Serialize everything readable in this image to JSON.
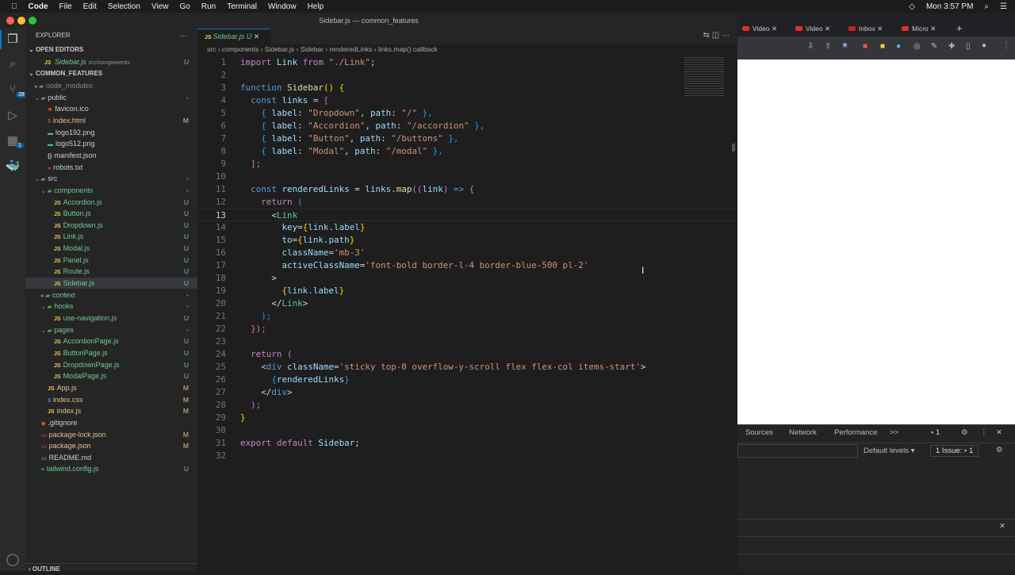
{
  "menubar": {
    "app": "Code",
    "items": [
      "File",
      "Edit",
      "Selection",
      "View",
      "Go",
      "Run",
      "Terminal",
      "Window",
      "Help"
    ],
    "clock": "Mon 3:57 PM"
  },
  "window": {
    "title": "Sidebar.js — common_features"
  },
  "activity": {
    "scm_badge": "28",
    "ext_badge": "1"
  },
  "explorer": {
    "title": "EXPLORER",
    "open_editors": "OPEN EDITORS",
    "open_file": "Sidebar.js",
    "open_file_path": "src/components",
    "open_file_status": "U",
    "project": "COMMON_FEATURES",
    "outline": "OUTLINE",
    "rows": [
      {
        "name": "node_modules",
        "indent": 1,
        "kind": "folder",
        "status": "",
        "color": "#888"
      },
      {
        "name": "public",
        "indent": 1,
        "kind": "folder-open",
        "status": "•",
        "color": "#ccc"
      },
      {
        "name": "favicon.ico",
        "indent": 2,
        "kind": "ico",
        "status": "",
        "color": "#ccc"
      },
      {
        "name": "index.html",
        "indent": 2,
        "kind": "html",
        "status": "M",
        "color": "#e2c08d"
      },
      {
        "name": "logo192.png",
        "indent": 2,
        "kind": "img",
        "status": "",
        "color": "#ccc"
      },
      {
        "name": "logo512.png",
        "indent": 2,
        "kind": "img",
        "status": "",
        "color": "#ccc"
      },
      {
        "name": "manifest.json",
        "indent": 2,
        "kind": "json",
        "status": "",
        "color": "#ccc"
      },
      {
        "name": "robots.txt",
        "indent": 2,
        "kind": "txt",
        "status": "",
        "color": "#ccc"
      },
      {
        "name": "src",
        "indent": 1,
        "kind": "folder-open",
        "status": "•",
        "color": "#ccc"
      },
      {
        "name": "components",
        "indent": 2,
        "kind": "folder-open",
        "status": "•",
        "color": "#73c991"
      },
      {
        "name": "Accordion.js",
        "indent": 3,
        "kind": "js",
        "status": "U",
        "color": "#73c991"
      },
      {
        "name": "Button.js",
        "indent": 3,
        "kind": "js",
        "status": "U",
        "color": "#73c991"
      },
      {
        "name": "Dropdown.js",
        "indent": 3,
        "kind": "js",
        "status": "U",
        "color": "#73c991"
      },
      {
        "name": "Link.js",
        "indent": 3,
        "kind": "js",
        "status": "U",
        "color": "#73c991"
      },
      {
        "name": "Modal.js",
        "indent": 3,
        "kind": "js",
        "status": "U",
        "color": "#73c991"
      },
      {
        "name": "Panel.js",
        "indent": 3,
        "kind": "js",
        "status": "U",
        "color": "#73c991"
      },
      {
        "name": "Route.js",
        "indent": 3,
        "kind": "js",
        "status": "U",
        "color": "#73c991"
      },
      {
        "name": "Sidebar.js",
        "indent": 3,
        "kind": "js",
        "status": "U",
        "color": "#73c991",
        "selected": true
      },
      {
        "name": "context",
        "indent": 2,
        "kind": "folder",
        "status": "•",
        "color": "#73c991"
      },
      {
        "name": "hooks",
        "indent": 2,
        "kind": "folder-open",
        "status": "•",
        "color": "#73c991"
      },
      {
        "name": "use-navigation.js",
        "indent": 3,
        "kind": "js",
        "status": "U",
        "color": "#73c991"
      },
      {
        "name": "pages",
        "indent": 2,
        "kind": "folder-open",
        "status": "•",
        "color": "#73c991"
      },
      {
        "name": "AccordionPage.js",
        "indent": 3,
        "kind": "js",
        "status": "U",
        "color": "#73c991"
      },
      {
        "name": "ButtonPage.js",
        "indent": 3,
        "kind": "js",
        "status": "U",
        "color": "#73c991"
      },
      {
        "name": "DropdownPage.js",
        "indent": 3,
        "kind": "js",
        "status": "U",
        "color": "#73c991"
      },
      {
        "name": "ModalPage.js",
        "indent": 3,
        "kind": "js",
        "status": "U",
        "color": "#73c991"
      },
      {
        "name": "App.js",
        "indent": 2,
        "kind": "js",
        "status": "M",
        "color": "#e2c08d"
      },
      {
        "name": "index.css",
        "indent": 2,
        "kind": "css",
        "status": "M",
        "color": "#e2c08d"
      },
      {
        "name": "index.js",
        "indent": 2,
        "kind": "js",
        "status": "M",
        "color": "#e2c08d"
      },
      {
        "name": ".gitignore",
        "indent": 1,
        "kind": "git",
        "status": "",
        "color": "#ccc"
      },
      {
        "name": "package-lock.json",
        "indent": 1,
        "kind": "npm",
        "status": "M",
        "color": "#e2c08d"
      },
      {
        "name": "package.json",
        "indent": 1,
        "kind": "npm",
        "status": "M",
        "color": "#e2c08d"
      },
      {
        "name": "README.md",
        "indent": 1,
        "kind": "md",
        "status": "",
        "color": "#ccc"
      },
      {
        "name": "tailwind.config.js",
        "indent": 1,
        "kind": "tw",
        "status": "U",
        "color": "#73c991"
      }
    ]
  },
  "editor": {
    "tab": "Sidebar.js",
    "tab_status": "U",
    "breadcrumbs": [
      "src",
      "components",
      "Sidebar.js",
      "Sidebar",
      "renderedLinks",
      "links.map() callback"
    ],
    "current_line": 13,
    "lines": [
      [
        [
          "import",
          "kw"
        ],
        [
          " Link ",
          "var"
        ],
        [
          "from",
          "kw"
        ],
        [
          " \"./Link\"",
          "str"
        ],
        [
          ";",
          "p"
        ]
      ],
      [],
      [
        [
          "function",
          "st2"
        ],
        [
          " Sidebar",
          "fn"
        ],
        [
          "() ",
          "b1"
        ],
        [
          "{",
          "b1"
        ]
      ],
      [
        [
          "  const",
          "st2"
        ],
        [
          " links ",
          "var"
        ],
        [
          "= ",
          "p"
        ],
        [
          "[",
          "b2"
        ]
      ],
      [
        [
          "    { ",
          "b3"
        ],
        [
          "label",
          "var"
        ],
        [
          ": ",
          "p"
        ],
        [
          "\"Dropdown\"",
          "str"
        ],
        [
          ", ",
          "p"
        ],
        [
          "path",
          "var"
        ],
        [
          ": ",
          "p"
        ],
        [
          "\"/\"",
          "str"
        ],
        [
          " },",
          "b3"
        ]
      ],
      [
        [
          "    { ",
          "b3"
        ],
        [
          "label",
          "var"
        ],
        [
          ": ",
          "p"
        ],
        [
          "\"Accordion\"",
          "str"
        ],
        [
          ", ",
          "p"
        ],
        [
          "path",
          "var"
        ],
        [
          ": ",
          "p"
        ],
        [
          "\"/accordion\"",
          "str"
        ],
        [
          " },",
          "b3"
        ]
      ],
      [
        [
          "    { ",
          "b3"
        ],
        [
          "label",
          "var"
        ],
        [
          ": ",
          "p"
        ],
        [
          "\"Button\"",
          "str"
        ],
        [
          ", ",
          "p"
        ],
        [
          "path",
          "var"
        ],
        [
          ": ",
          "p"
        ],
        [
          "\"/buttons\"",
          "str"
        ],
        [
          " },",
          "b3"
        ]
      ],
      [
        [
          "    { ",
          "b3"
        ],
        [
          "label",
          "var"
        ],
        [
          ": ",
          "p"
        ],
        [
          "\"Modal\"",
          "str"
        ],
        [
          ", ",
          "p"
        ],
        [
          "path",
          "var"
        ],
        [
          ": ",
          "p"
        ],
        [
          "\"/modal\"",
          "str"
        ],
        [
          " },",
          "b3"
        ]
      ],
      [
        [
          "  ];",
          "b2"
        ]
      ],
      [],
      [
        [
          "  const",
          "st2"
        ],
        [
          " renderedLinks ",
          "var"
        ],
        [
          "= ",
          "p"
        ],
        [
          "links",
          "var"
        ],
        [
          ".",
          "p"
        ],
        [
          "map",
          "fn"
        ],
        [
          "((",
          "b2"
        ],
        [
          "link",
          "var"
        ],
        [
          ") ",
          "b2"
        ],
        [
          "=> ",
          "st2"
        ],
        [
          "{",
          "b2"
        ]
      ],
      [
        [
          "    return ",
          "kw"
        ],
        [
          "(",
          "b3"
        ]
      ],
      [
        [
          "      <",
          "p"
        ],
        [
          "Link",
          "tag"
        ]
      ],
      [
        [
          "        key",
          "var"
        ],
        [
          "=",
          "p"
        ],
        [
          "{",
          "b1"
        ],
        [
          "link.label",
          "var"
        ],
        [
          "}",
          "b1"
        ]
      ],
      [
        [
          "        to",
          "var"
        ],
        [
          "=",
          "p"
        ],
        [
          "{",
          "b1"
        ],
        [
          "link.path",
          "var"
        ],
        [
          "}",
          "b1"
        ]
      ],
      [
        [
          "        className",
          "var"
        ],
        [
          "=",
          "p"
        ],
        [
          "'mb-3'",
          "str"
        ]
      ],
      [
        [
          "        activeClassName",
          "var"
        ],
        [
          "=",
          "p"
        ],
        [
          "'font-bold border-l-4 border-blue-500 pl-2'",
          "str"
        ]
      ],
      [
        [
          "      >",
          "p"
        ]
      ],
      [
        [
          "        {",
          "b1"
        ],
        [
          "link.label",
          "var"
        ],
        [
          "}",
          "b1"
        ]
      ],
      [
        [
          "      </",
          "p"
        ],
        [
          "Link",
          "tag"
        ],
        [
          ">",
          "p"
        ]
      ],
      [
        [
          "    );",
          "b3"
        ]
      ],
      [
        [
          "  });",
          "b2"
        ]
      ],
      [],
      [
        [
          "  return ",
          "kw"
        ],
        [
          "(",
          "b2"
        ]
      ],
      [
        [
          "    <",
          "p"
        ],
        [
          "div ",
          "st2"
        ],
        [
          "className",
          "var"
        ],
        [
          "=",
          "p"
        ],
        [
          "'sticky top-0 overflow-y-scroll flex flex-col items-start'",
          "str"
        ],
        [
          ">",
          "p"
        ]
      ],
      [
        [
          "      {",
          "b3"
        ],
        [
          "renderedLinks",
          "var"
        ],
        [
          "}",
          "b3"
        ]
      ],
      [
        [
          "    </",
          "p"
        ],
        [
          "div",
          "st2"
        ],
        [
          ">",
          "p"
        ]
      ],
      [
        [
          "  );",
          "b2"
        ]
      ],
      [
        [
          "}",
          "b1"
        ]
      ],
      [],
      [
        [
          "export ",
          "kw"
        ],
        [
          "default ",
          "kw"
        ],
        [
          "Sidebar",
          "var"
        ],
        [
          ";",
          "p"
        ]
      ],
      []
    ]
  },
  "browser": {
    "tabs": [
      "Video",
      "Video",
      "Inbox",
      "Micro"
    ],
    "new_tab": "+"
  },
  "devtools": {
    "tabs": [
      "Sources",
      "Network",
      "Performance"
    ],
    "more": ">>",
    "msg_count": "1",
    "filter_levels": "Default levels ▾",
    "issues_label": "1 Issue:",
    "issues_count": "1"
  }
}
